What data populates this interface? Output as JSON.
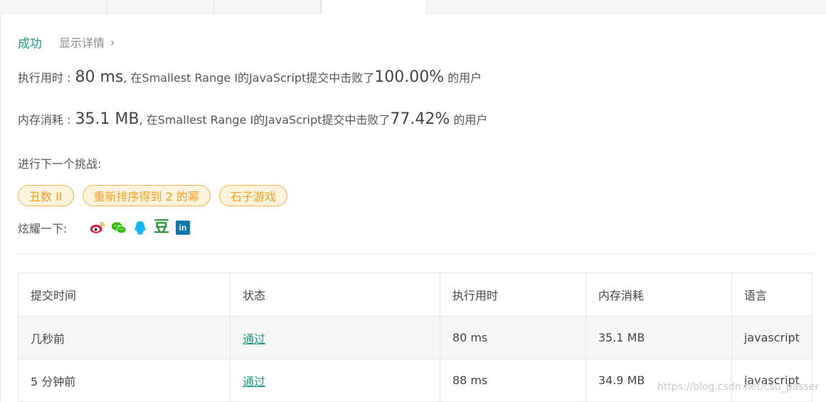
{
  "status": {
    "result": "成功",
    "details_link": "显示详情"
  },
  "runtime": {
    "label": "执行用时 :",
    "value": "80 ms",
    "mid_text": ", 在Smallest Range I的JavaScript提交中击败了",
    "percent": "100.00%",
    "suffix": "的用户"
  },
  "memory": {
    "label": "内存消耗 :",
    "value": "35.1 MB",
    "mid_text": ", 在Smallest Range I的JavaScript提交中击败了",
    "percent": "77.42%",
    "suffix": "的用户"
  },
  "next_challenge": {
    "label": "进行下一个挑战:",
    "items": [
      "丑数 II",
      "重新排序得到 2 的幂",
      "石子游戏"
    ]
  },
  "share": {
    "label": "炫耀一下:",
    "icons": [
      "weibo-icon",
      "wechat-icon",
      "qq-icon",
      "douban-icon",
      "linkedin-icon"
    ],
    "douban_glyph": "豆",
    "linkedin_glyph": "in"
  },
  "table": {
    "headers": [
      "提交时间",
      "状态",
      "执行用时",
      "内存消耗",
      "语言"
    ],
    "rows": [
      [
        "几秒前",
        "通过",
        "80 ms",
        "35.1 MB",
        "javascript"
      ],
      [
        "5 分钟前",
        "通过",
        "88 ms",
        "34.9 MB",
        "javascript"
      ]
    ]
  },
  "watermark": "https://blog.csdn.net/csu_passer",
  "colors": {
    "success": "#1a9a86",
    "chip_border": "#f0b64a",
    "chip_bg": "#fff3de",
    "chip_text": "#f0a020"
  }
}
